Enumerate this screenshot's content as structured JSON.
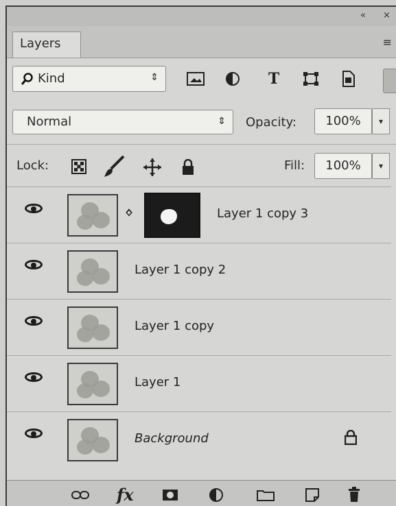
{
  "panel": {
    "collapse_glyph": "«",
    "close_glyph": "×",
    "tab_label": "Layers",
    "menu_glyph": "≡"
  },
  "filter": {
    "kind_label": "Kind",
    "arrows": "⇕",
    "icons": [
      "image-filter-icon",
      "adjustment-filter-icon",
      "type-filter-icon",
      "shape-filter-icon",
      "smart-object-filter-icon"
    ]
  },
  "blend": {
    "mode": "Normal",
    "arrows": "⇕",
    "opacity_label": "Opacity:",
    "opacity_value": "100%",
    "dropdown_glyph": "▾"
  },
  "lock": {
    "label": "Lock:",
    "fill_label": "Fill:",
    "fill_value": "100%",
    "dropdown_glyph": "▾"
  },
  "layers": [
    {
      "name": "Layer 1 copy 3",
      "visible": true,
      "has_mask": true
    },
    {
      "name": "Layer 1 copy 2",
      "visible": true
    },
    {
      "name": "Layer 1 copy",
      "visible": true
    },
    {
      "name": "Layer 1",
      "visible": true
    },
    {
      "name": "Background",
      "visible": true,
      "locked": true
    }
  ],
  "bottom_icons": [
    "link-layers-icon",
    "fx-icon",
    "add-mask-icon",
    "adjustment-layer-icon",
    "new-group-icon",
    "new-layer-icon",
    "delete-icon"
  ],
  "bottom_fx_label": "fx"
}
